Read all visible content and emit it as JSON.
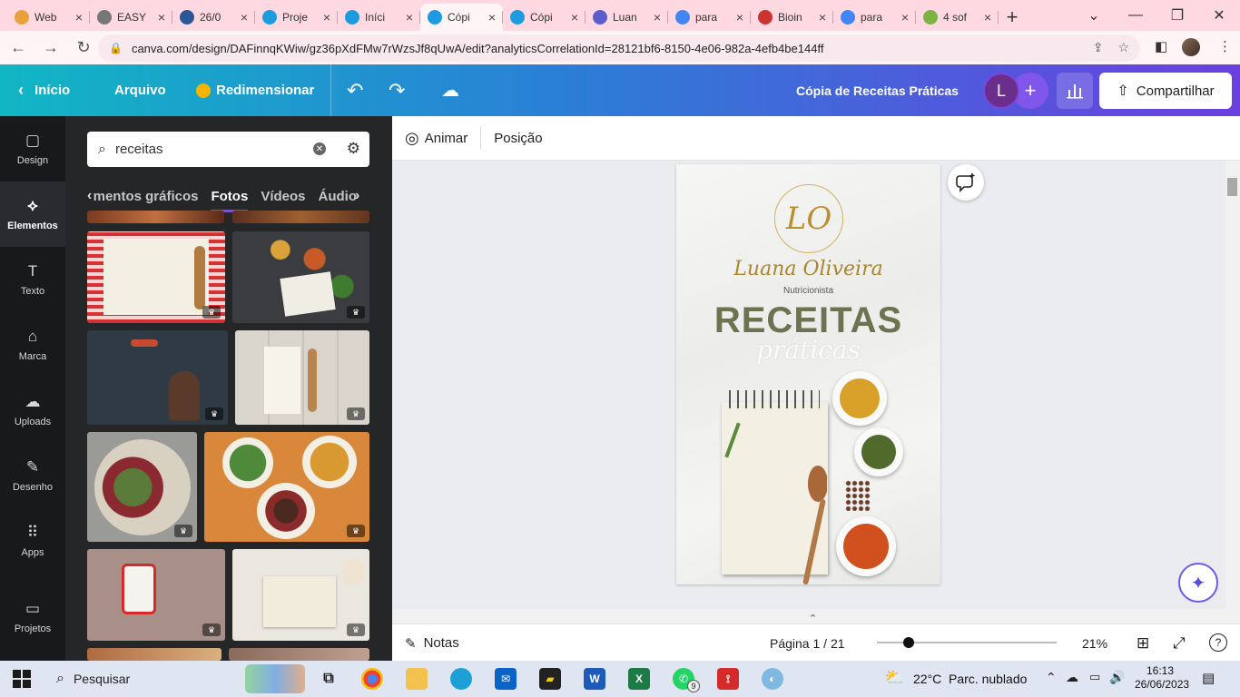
{
  "browser": {
    "tabs": [
      {
        "title": "Web",
        "color": "#e9a13b"
      },
      {
        "title": "EASY",
        "color": "#777777"
      },
      {
        "title": "26/0",
        "color": "#2b5797"
      },
      {
        "title": "Proje",
        "color": "#1d9be0"
      },
      {
        "title": "Iníci",
        "color": "#1d9be0"
      },
      {
        "title": "Cópi",
        "color": "#1d9be0",
        "active": true
      },
      {
        "title": "Cópi",
        "color": "#1d9be0"
      },
      {
        "title": "Luan",
        "color": "#5c5ccf"
      },
      {
        "title": "para",
        "color": "#4285f4"
      },
      {
        "title": "Bioin",
        "color": "#cc3333"
      },
      {
        "title": "para",
        "color": "#4285f4"
      },
      {
        "title": "4 sof",
        "color": "#7cb342"
      }
    ],
    "url": "canva.com/design/DAFinnqKWiw/gz36pXdFMw7rWzsJf8qUwA/edit?analyticsCorrelationId=28121bf6-8150-4e06-982a-4efb4be144ff"
  },
  "topbar": {
    "inicio": "Início",
    "arquivo": "Arquivo",
    "redimensionar": "Redimensionar",
    "doc_title": "Cópia de Receitas Práticas",
    "avatar_letter": "L",
    "share": "Compartilhar"
  },
  "rail": [
    {
      "label": "Design",
      "icon": "design-icon",
      "glyph": "▢"
    },
    {
      "label": "Elementos",
      "icon": "elements-icon",
      "glyph": "⟡",
      "active": true
    },
    {
      "label": "Texto",
      "icon": "text-icon",
      "glyph": "T"
    },
    {
      "label": "Marca",
      "icon": "brand-icon",
      "glyph": "⌂"
    },
    {
      "label": "Uploads",
      "icon": "upload-icon",
      "glyph": "☁"
    },
    {
      "label": "Desenho",
      "icon": "draw-icon",
      "glyph": "✎"
    },
    {
      "label": "Apps",
      "icon": "apps-icon",
      "glyph": "⠿"
    },
    {
      "label": "Projetos",
      "icon": "folder-icon",
      "glyph": "▭"
    }
  ],
  "panel": {
    "search_value": "receitas",
    "categories": [
      "mentos gráficos",
      "Fotos",
      "Vídeos",
      "Áudio"
    ],
    "selected_category": "Fotos"
  },
  "editor": {
    "animar": "Animar",
    "posicao": "Posição"
  },
  "design": {
    "logo_initials": "LO",
    "brand_name": "Luana Oliveira",
    "brand_sub": "Nutricionista",
    "headline": "RECEITAS",
    "subheadline": "práticas"
  },
  "footer": {
    "notas": "Notas",
    "page_indicator": "Página 1 / 21",
    "zoom": "21%"
  },
  "taskbar": {
    "search": "Pesquisar",
    "weather_temp": "22°C",
    "weather_desc": "Parc. nublado",
    "time": "16:13",
    "date": "26/06/2023",
    "whatsapp_badge": "9"
  }
}
